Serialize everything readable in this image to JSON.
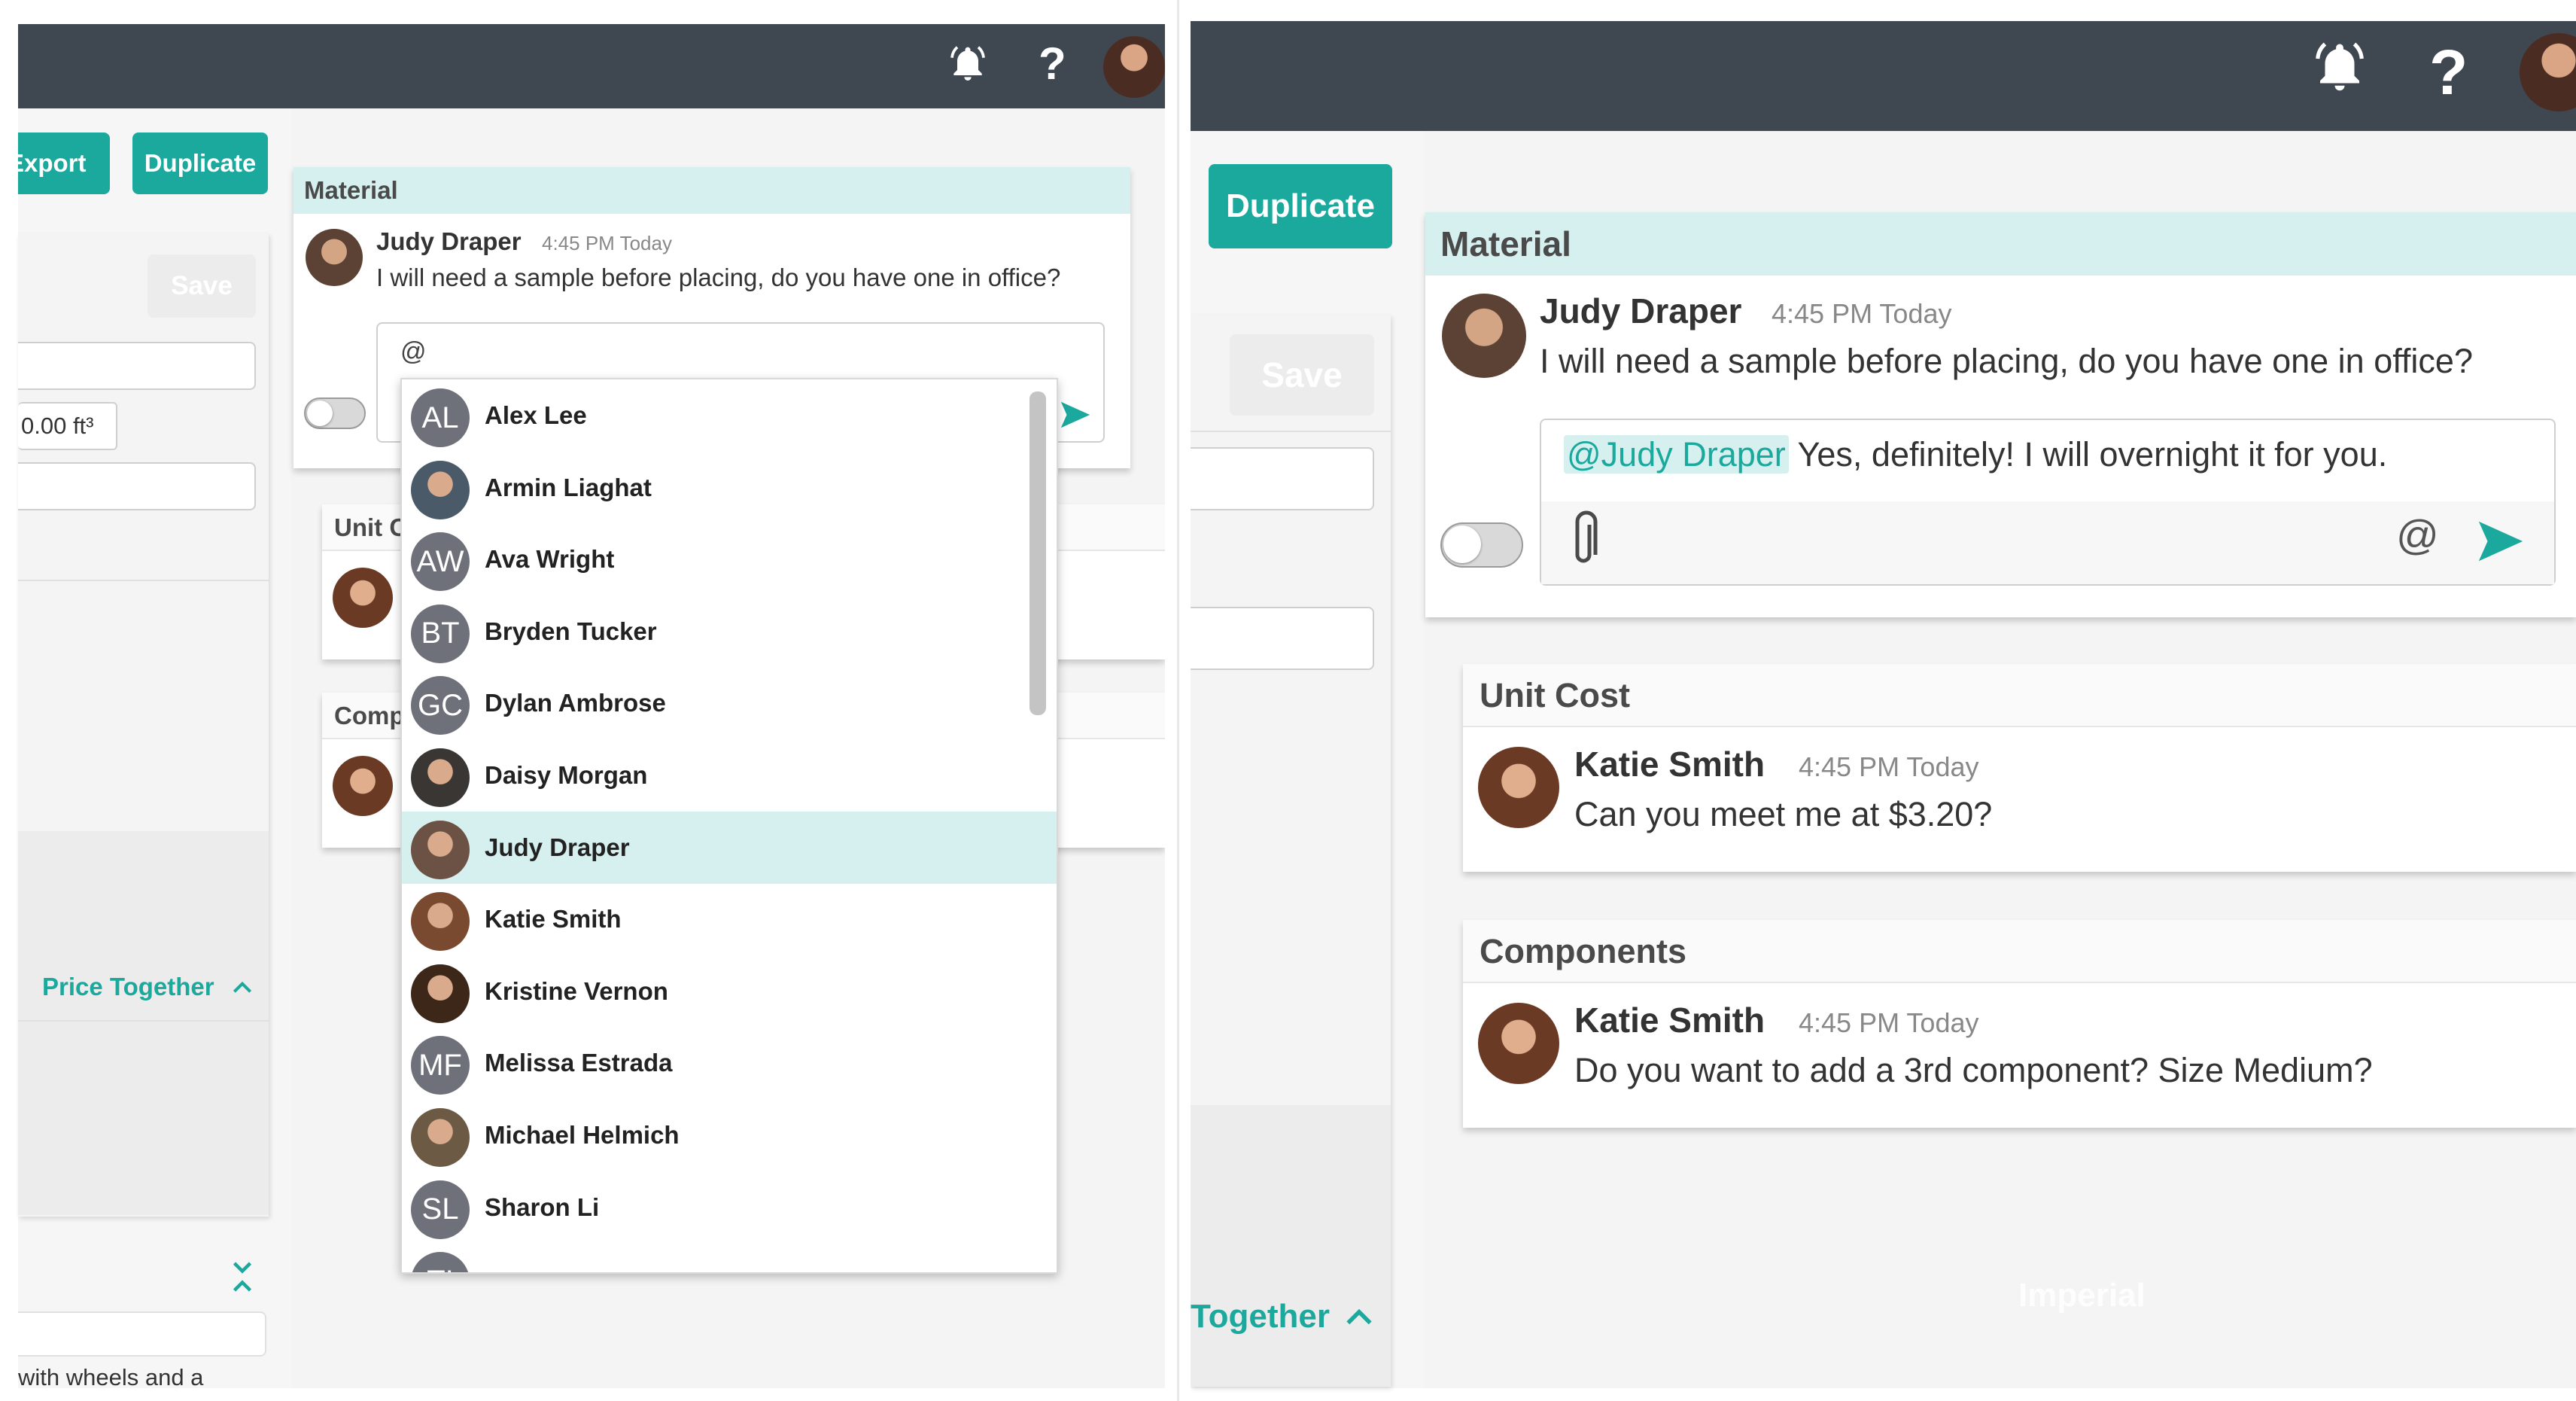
{
  "left": {
    "export_label": "Export",
    "duplicate_label": "Duplicate",
    "save_label": "Save",
    "volume_value": "0.00 ft³",
    "price_together_label": "Price Together",
    "description_snippet": "with wheels and a",
    "material_header": "Material",
    "unit_cost_header": "Unit C",
    "components_header": "Comp",
    "message": {
      "name": "Judy Draper",
      "time": "4:45 PM Today",
      "text": "I will need a sample before placing, do you have one in office?"
    },
    "compose_value": "@",
    "mention_list": [
      {
        "name": "Alex Lee",
        "initials": "AL",
        "photo": false
      },
      {
        "name": "Armin Liaghat",
        "initials": "",
        "photo": true,
        "tone": "#4a5a68"
      },
      {
        "name": "Ava Wright",
        "initials": "AW",
        "photo": false
      },
      {
        "name": "Bryden Tucker",
        "initials": "BT",
        "photo": false
      },
      {
        "name": "Dylan Ambrose",
        "initials": "GC",
        "photo": false
      },
      {
        "name": "Daisy Morgan",
        "initials": "",
        "photo": true,
        "tone": "#3a3634"
      },
      {
        "name": "Judy Draper",
        "initials": "",
        "photo": true,
        "tone": "#6b5244"
      },
      {
        "name": "Katie Smith",
        "initials": "",
        "photo": true,
        "tone": "#7a4a30"
      },
      {
        "name": "Kristine Vernon",
        "initials": "",
        "photo": true,
        "tone": "#3c2718"
      },
      {
        "name": "Melissa Estrada",
        "initials": "MF",
        "photo": false
      },
      {
        "name": "Michael Helmich",
        "initials": "",
        "photo": true,
        "tone": "#6d5a45"
      },
      {
        "name": "Sharon Li",
        "initials": "SL",
        "photo": false
      },
      {
        "name": "",
        "initials": "TI",
        "photo": false
      }
    ],
    "highlighted_index": 6
  },
  "right": {
    "duplicate_label": "Duplicate",
    "save_label": "Save",
    "together_label": "Together",
    "imperial_label": "Imperial",
    "material_header": "Material",
    "material_message": {
      "name": "Judy Draper",
      "time": "4:45 PM Today",
      "text": "I will need a sample before placing, do you have one in office?"
    },
    "reply_mention": "@Judy Draper",
    "reply_text": "Yes, definitely! I will overnight it for you.",
    "at_label": "@",
    "unit_cost_header": "Unit Cost",
    "unit_cost_message": {
      "name": "Katie Smith",
      "time": "4:45 PM Today",
      "text": "Can you meet me at $3.20?"
    },
    "components_header": "Components",
    "components_message": {
      "name": "Katie Smith",
      "time": "4:45 PM Today",
      "text": "Do you want to add a 3rd component? Size Medium?"
    }
  },
  "colors": {
    "topbar": "#3f4751",
    "accent": "#1ba89d",
    "highlight": "#d6f0ef"
  },
  "icons": [
    "bell-icon",
    "help-icon",
    "paperclip-icon",
    "send-icon",
    "chevron-up-icon",
    "double-chevron-icon"
  ]
}
